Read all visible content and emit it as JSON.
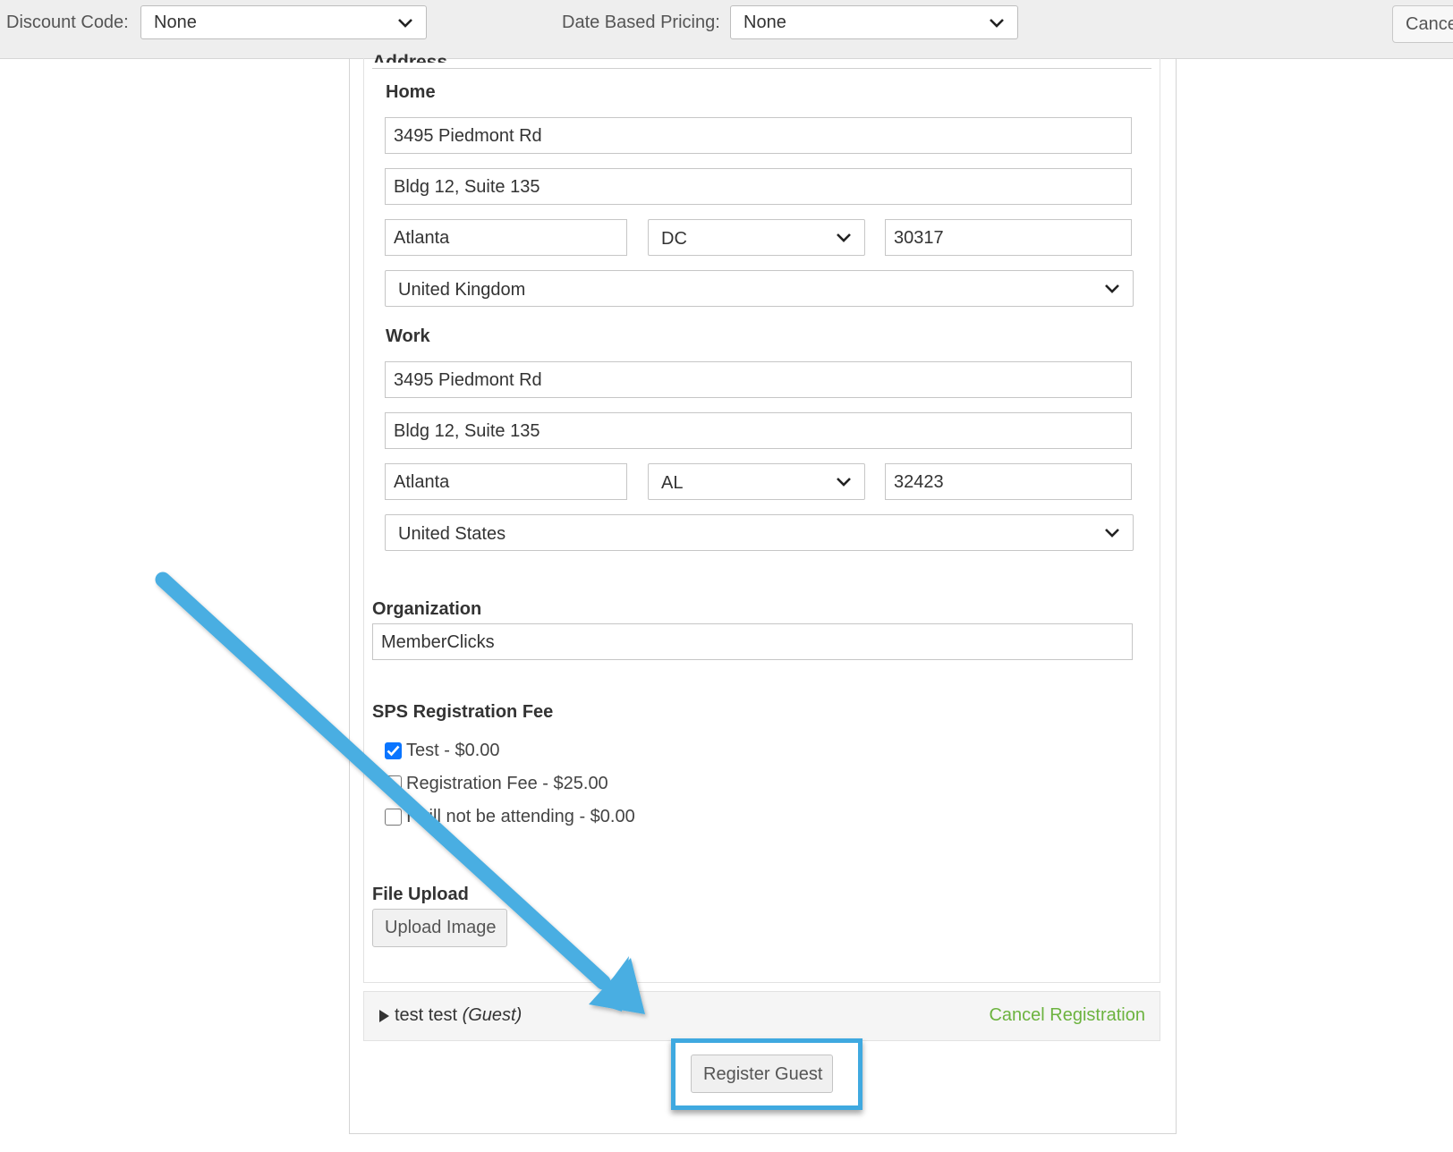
{
  "topbar": {
    "discount_label": "Discount Code:",
    "discount_value": "None",
    "pricing_label": "Date Based Pricing:",
    "pricing_value": "None",
    "cancel_label": "Cancel"
  },
  "address": {
    "legend": "Address",
    "home": {
      "label": "Home",
      "line1": "3495 Piedmont Rd",
      "line2": "Bldg 12, Suite 135",
      "city": "Atlanta",
      "state": "DC",
      "zip": "30317",
      "country": "United Kingdom"
    },
    "work": {
      "label": "Work",
      "line1": "3495 Piedmont Rd",
      "line2": "Bldg 12, Suite 135",
      "city": "Atlanta",
      "state": "AL",
      "zip": "32423",
      "country": "United States"
    }
  },
  "organization": {
    "label": "Organization",
    "value": "MemberClicks"
  },
  "fee": {
    "label": "SPS Registration Fee",
    "options": [
      {
        "label": "Test - $0.00",
        "checked": true
      },
      {
        "label": "Registration Fee - $25.00",
        "checked": false
      },
      {
        "label": "I will not be attending - $0.00",
        "checked": false
      }
    ]
  },
  "upload": {
    "label": "File Upload",
    "button": "Upload Image"
  },
  "guest": {
    "name": "test test",
    "tag": "(Guest)",
    "cancel": "Cancel Registration"
  },
  "register_button": "Register Guest",
  "colors": {
    "highlight": "#3fa9e0",
    "cancel_link": "#6cb33f",
    "checkbox_checked": "#0a75ff"
  },
  "icons": [
    "chevron-down-icon",
    "triangle-right-icon",
    "check-icon",
    "arrow-annotation-icon"
  ]
}
